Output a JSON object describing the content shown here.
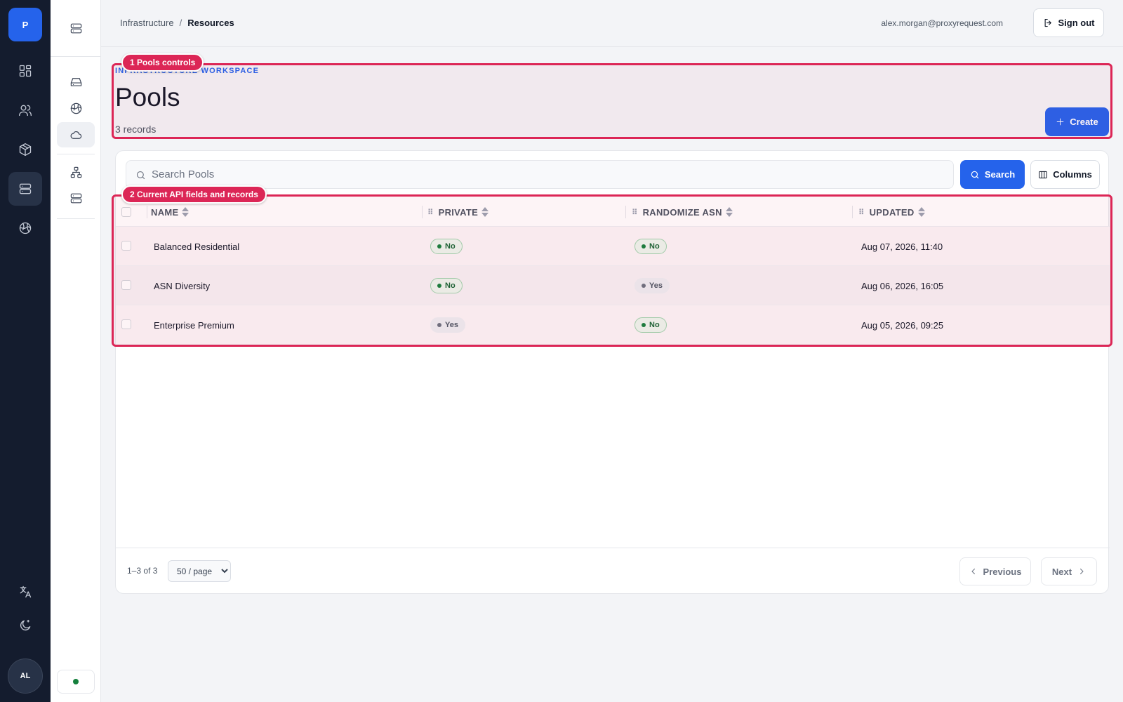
{
  "rail": {
    "logo_letter": "P",
    "avatar_initials": "AL",
    "items": [
      {
        "icon": "dashboard-icon",
        "active": false
      },
      {
        "icon": "users-icon",
        "active": false
      },
      {
        "icon": "box-icon",
        "active": false
      },
      {
        "icon": "server-icon",
        "active": true
      },
      {
        "icon": "globe-icon",
        "active": false
      }
    ],
    "bottom_items": [
      {
        "icon": "translate-icon"
      },
      {
        "icon": "dark-mode-icon"
      }
    ]
  },
  "sidebar": {
    "items": [
      {
        "icon": "storage-icon"
      },
      {
        "icon": "network-icon"
      },
      {
        "icon": "cloud-icon",
        "active": true
      },
      {
        "icon": "hierarchy-icon"
      },
      {
        "icon": "server-stack-icon"
      }
    ],
    "status": "online"
  },
  "header": {
    "breadcrumb_root": "Infrastructure",
    "breadcrumb_separator": "/",
    "breadcrumb_current": "Resources",
    "user_email": "alex.morgan@proxyrequest.com",
    "sign_out_label": "Sign out"
  },
  "page": {
    "workspace_label": "INFRASTRUCTURE WORKSPACE",
    "title": "Pools",
    "record_count": "3 records",
    "create_label": "Create"
  },
  "toolbar": {
    "search_placeholder": "Search Pools",
    "search_value": "",
    "search_button": "Search",
    "columns_button": "Columns"
  },
  "table": {
    "columns": [
      "NAME",
      "PRIVATE",
      "RANDOMIZE ASN",
      "UPDATED"
    ],
    "rows": [
      {
        "name": "Balanced Residential",
        "private": "No",
        "randomize_asn": "No",
        "updated": "Aug 07, 2026, 11:40"
      },
      {
        "name": "ASN Diversity",
        "private": "No",
        "randomize_asn": "Yes",
        "updated": "Aug 06, 2026, 16:05"
      },
      {
        "name": "Enterprise Premium",
        "private": "Yes",
        "randomize_asn": "No",
        "updated": "Aug 05, 2026, 09:25"
      }
    ]
  },
  "pagination": {
    "range": "1–3 of 3",
    "page_size": "50 / page",
    "previous": "Previous",
    "next": "Next"
  },
  "annotations": [
    {
      "number": "1",
      "label": "1 Pools controls"
    },
    {
      "number": "2",
      "label": "2 Current API fields and records"
    }
  ],
  "colors": {
    "accent": "#2563eb",
    "rail_bg": "#141c2e",
    "annotation": "#dc2656",
    "badge_green": "#15803d"
  }
}
